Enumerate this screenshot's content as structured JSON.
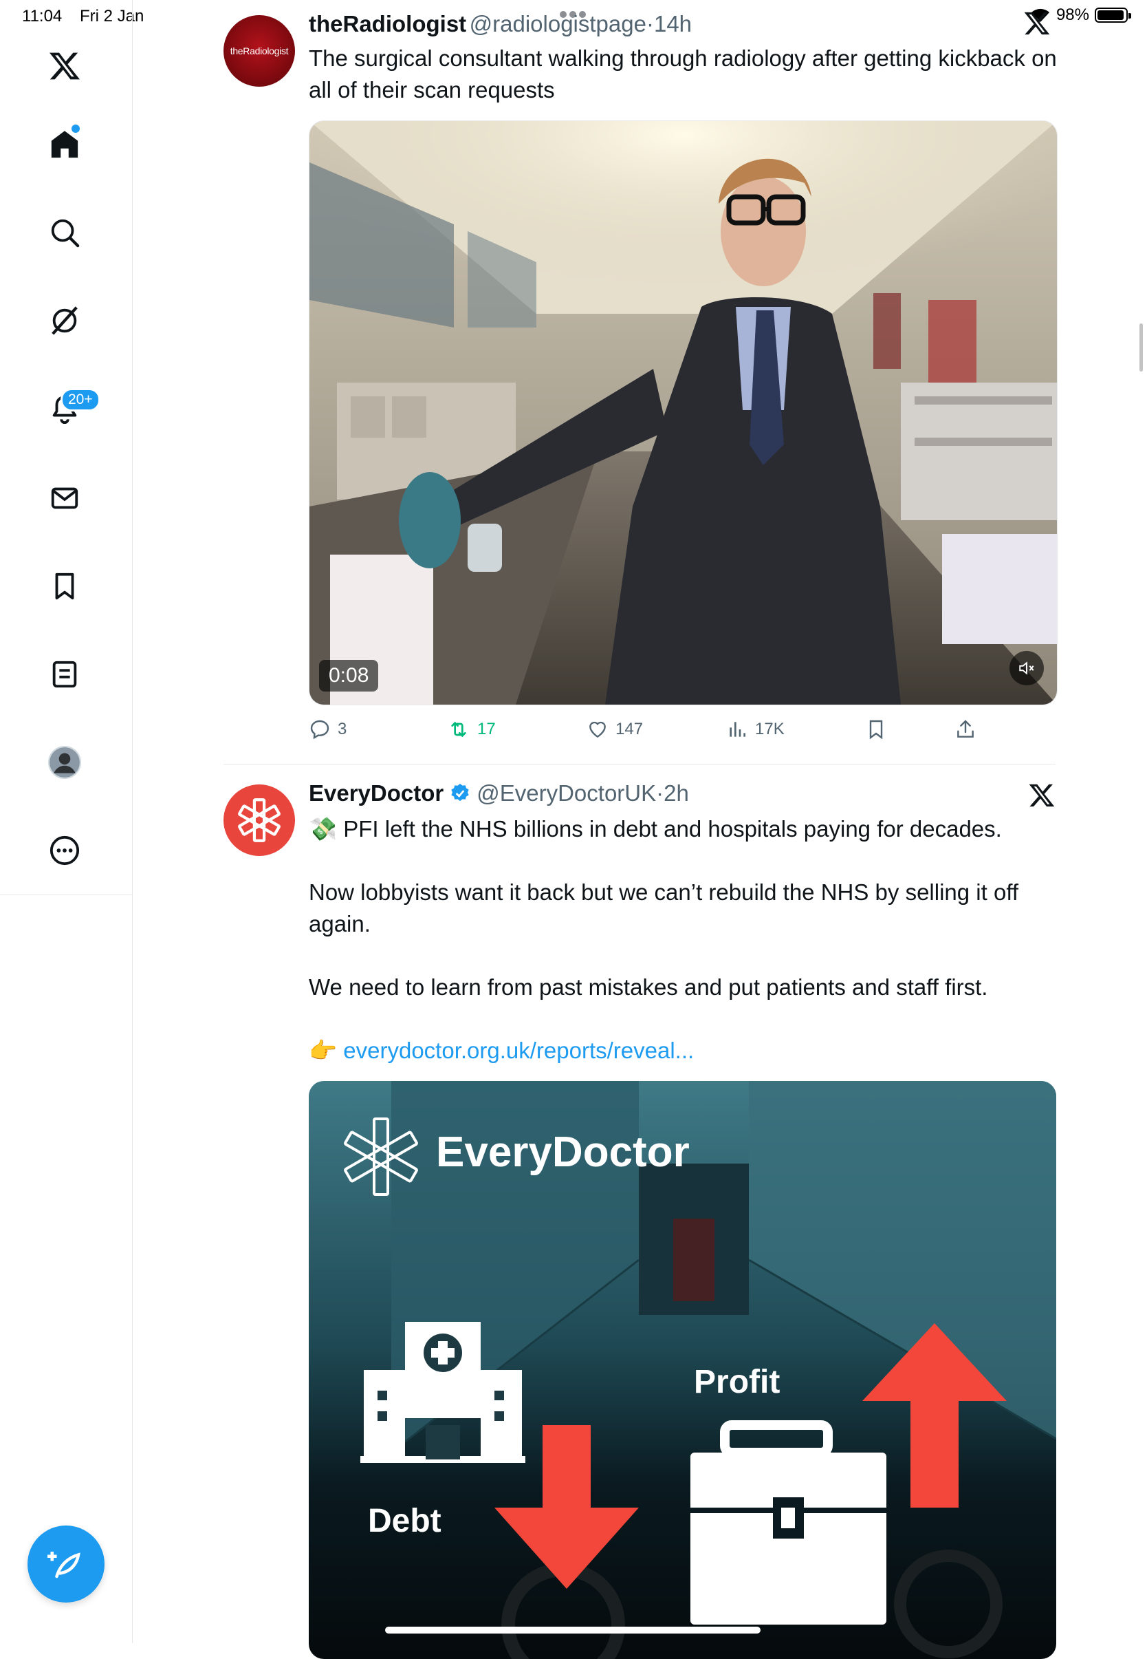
{
  "status_bar": {
    "time": "11:04",
    "date": "Fri 2 Jan",
    "battery": "98%"
  },
  "sidebar": {
    "items": [
      {
        "name": "x-logo"
      },
      {
        "name": "home"
      },
      {
        "name": "search"
      },
      {
        "name": "grok"
      },
      {
        "name": "notifications",
        "badge": "20+"
      },
      {
        "name": "messages"
      },
      {
        "name": "bookmarks"
      },
      {
        "name": "lists"
      },
      {
        "name": "profile"
      },
      {
        "name": "more"
      }
    ]
  },
  "tweets": [
    {
      "avatar_text": "theRadiologist",
      "name": "theRadiologist",
      "handle": "@radiologistpage",
      "separator": "·",
      "time": "14h",
      "text": "The surgical consultant walking through radiology after getting kickback on all of their scan requests",
      "video_duration": "0:08",
      "replies": "3",
      "retweets": "17",
      "likes": "147",
      "views": "17K"
    },
    {
      "name": "EveryDoctor",
      "handle": "@EveryDoctorUK",
      "separator": "·",
      "time": "2h",
      "emoji1": "💸",
      "line1": "PFI left the NHS billions in debt and hospitals paying for decades.",
      "line2": "Now lobbyists want it back but we can’t rebuild the NHS by selling it off again.",
      "line3": "We need to learn from past mistakes and put patients and staff first.",
      "emoji2": "👉",
      "link": "everydoctor.org.uk/reports/reveal...",
      "image": {
        "brand": "EveryDoctor",
        "debt_label": "Debt",
        "profit_label": "Profit"
      }
    }
  ],
  "colors": {
    "accent": "#1d9bf0",
    "retweet_green": "#00ba7c",
    "everydoctor_red": "#e8453c",
    "arrow_red": "#f2473a"
  }
}
